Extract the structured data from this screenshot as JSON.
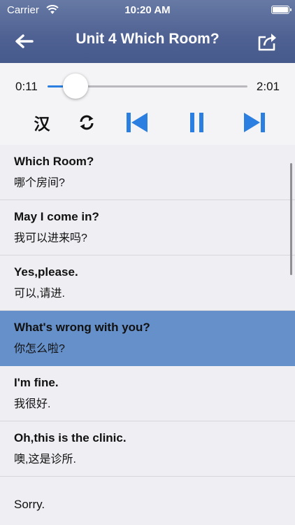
{
  "status_bar": {
    "carrier": "Carrier",
    "time": "10:20 AM"
  },
  "nav": {
    "title": "Unit 4 Which Room?"
  },
  "player": {
    "elapsed": "0:11",
    "duration": "2:01",
    "progress": 0.14,
    "cn_toggle_label": "汉"
  },
  "lines": [
    {
      "en": "Which Room?",
      "zh": "哪个房间?",
      "active": false
    },
    {
      "en": "May I come in?",
      "zh": "我可以进来吗?",
      "active": false
    },
    {
      "en": "Yes,please.",
      "zh": "可以,请进.",
      "active": false
    },
    {
      "en": "What's wrong with you?",
      "zh": "你怎么啦?",
      "active": true
    },
    {
      "en": "I'm fine.",
      "zh": "我很好.",
      "active": false
    },
    {
      "en": "Oh,this is the clinic.",
      "zh": "噢,这是诊所.",
      "active": false
    },
    {
      "en": "Sorry.",
      "zh": "",
      "active": false
    }
  ],
  "colors": {
    "header": "#4e6192",
    "accent": "#2b7fe0",
    "highlight_row": "#6690c9"
  },
  "icons": {
    "back": "arrow-left-icon",
    "share": "share-icon",
    "repeat": "repeat-icon",
    "prev": "skip-back-icon",
    "pause": "pause-icon",
    "next": "skip-forward-icon"
  }
}
